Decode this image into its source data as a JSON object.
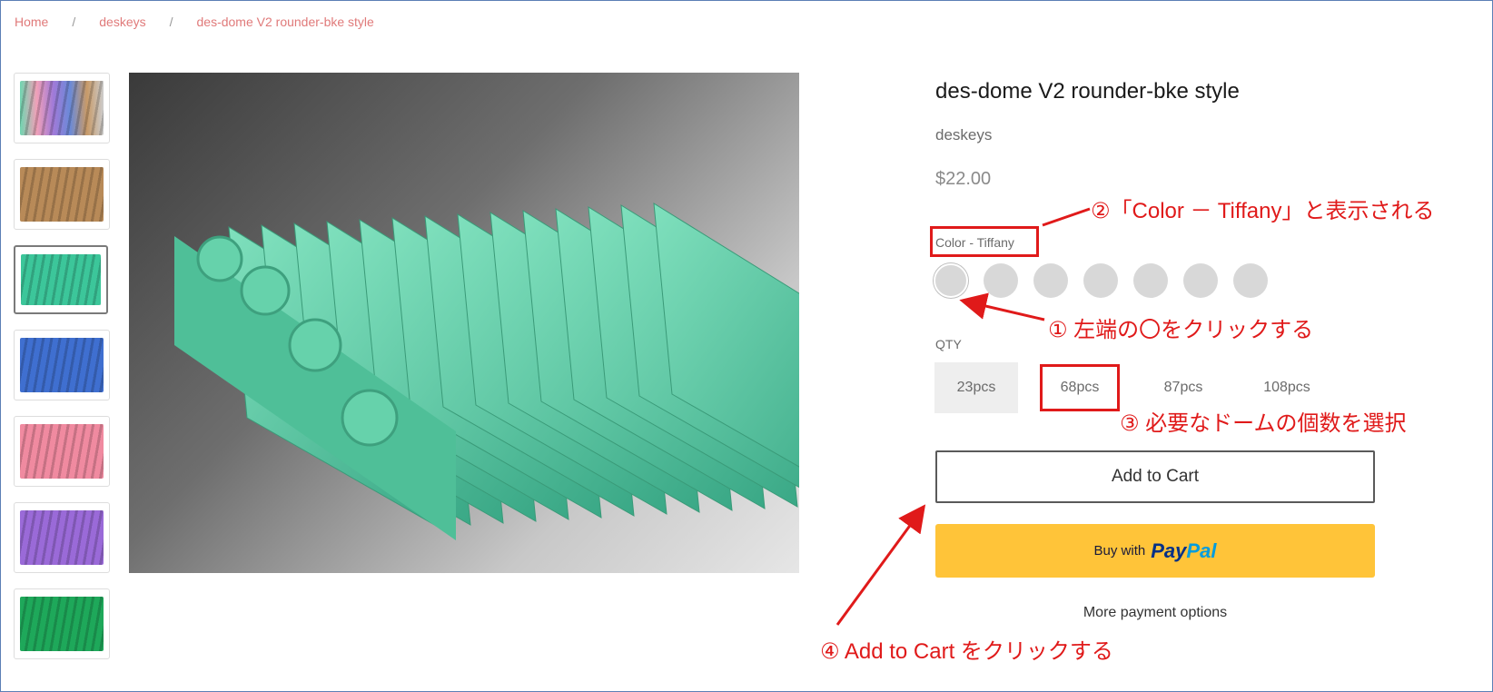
{
  "breadcrumb": {
    "home": "Home",
    "sep": "/",
    "collection": "deskeys",
    "current": "des-dome V2 rounder-bke style"
  },
  "thumbnails": [
    {
      "name": "thumb-multicolor",
      "color": "#c8a0c8"
    },
    {
      "name": "thumb-brown",
      "color": "#b88a58"
    },
    {
      "name": "thumb-tiffany",
      "color": "#3cc69a"
    },
    {
      "name": "thumb-blue",
      "color": "#3f6fd0"
    },
    {
      "name": "thumb-pink",
      "color": "#f08aa0"
    },
    {
      "name": "thumb-purple",
      "color": "#9a6ad8"
    },
    {
      "name": "thumb-green",
      "color": "#1ea85a"
    }
  ],
  "main_image": {
    "subject_color": "#55c9a3"
  },
  "product": {
    "title": "des-dome V2 rounder-bke style",
    "vendor": "deskeys",
    "price": "$22.00",
    "color_label": "Color - Tiffany",
    "swatch_count": 7,
    "qty_label": "QTY",
    "qty_options": [
      "23pcs",
      "68pcs",
      "87pcs",
      "108pcs"
    ],
    "add_to_cart": "Add to Cart",
    "paypal_prefix": "Buy with",
    "paypal_brand_1": "Pay",
    "paypal_brand_2": "Pal",
    "more_payment": "More payment options"
  },
  "annotations": {
    "a1": "① 左端の〇をクリックする",
    "a2": "②「Color － Tiffany」と表示される",
    "a3": "③ 必要なドームの個数を選択",
    "a4": "④ Add to Cart をクリックする"
  },
  "colors": {
    "annotation_red": "#e01a1a",
    "breadcrumb": "#e07a7a",
    "paypal_yellow": "#ffc439"
  }
}
